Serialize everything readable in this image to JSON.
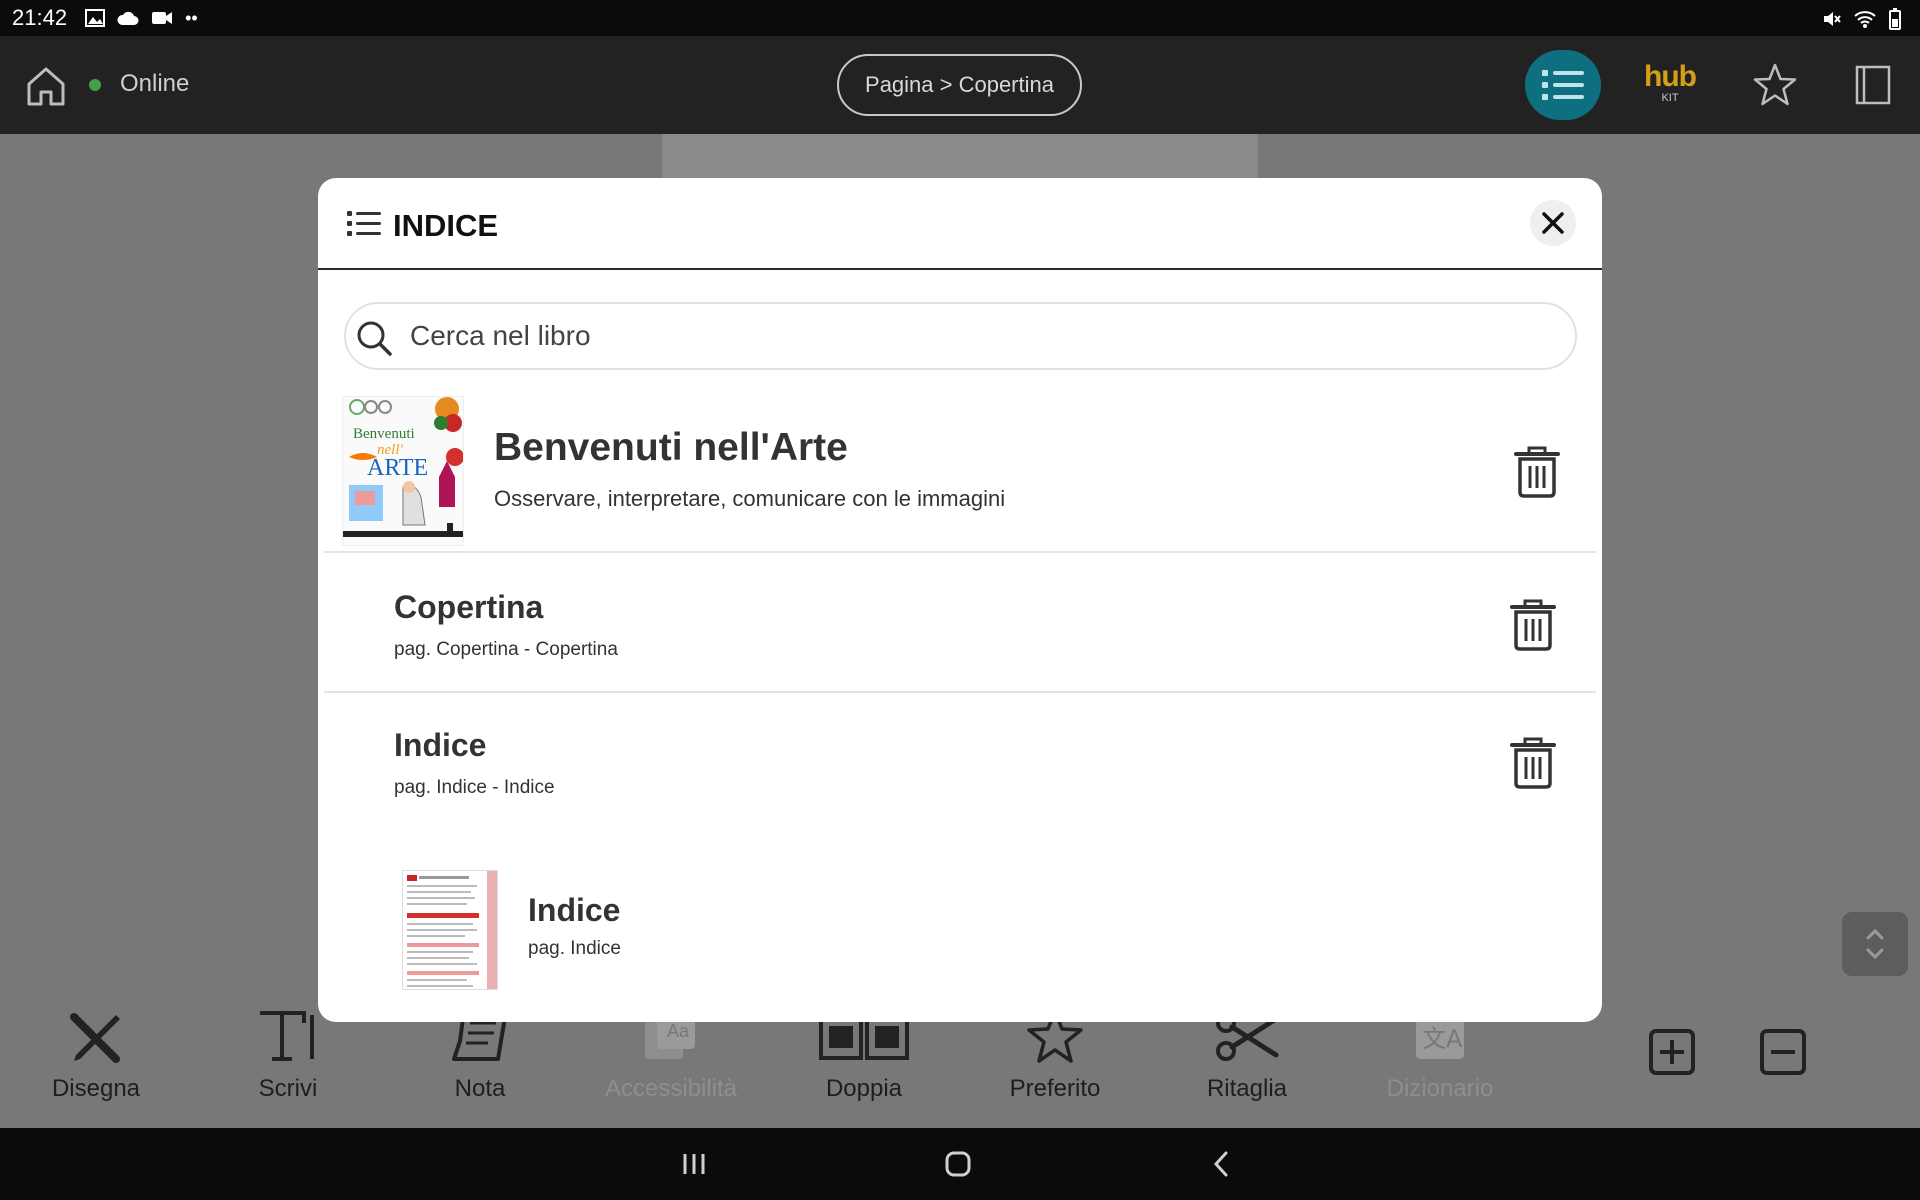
{
  "statusbar": {
    "time": "21:42"
  },
  "appbar": {
    "connection_status": "Online",
    "breadcrumb": "Pagina > Copertina",
    "hub_logo": "hub",
    "hub_logo_sub": "KIT"
  },
  "modal": {
    "title": "INDICE",
    "search_placeholder": "Cerca nel libro",
    "book": {
      "title": "Benvenuti nell'Arte",
      "subtitle": "Osservare, interpretare, comunicare con le immagini",
      "cover_text_1": "Benvenuti",
      "cover_text_2": "nell'",
      "cover_text_3": "ARTE"
    },
    "entries": [
      {
        "title": "Copertina",
        "subtitle": "pag. Copertina - Copertina"
      },
      {
        "title": "Indice",
        "subtitle": "pag. Indice - Indice"
      }
    ],
    "thumb_entry": {
      "title": "Indice",
      "subtitle": "pag. Indice"
    }
  },
  "toolbar": {
    "tools": [
      {
        "label": "Disegna",
        "icon": "pen-brush-icon",
        "enabled": true
      },
      {
        "label": "Scrivi",
        "icon": "text-icon",
        "enabled": true
      },
      {
        "label": "Nota",
        "icon": "note-icon",
        "enabled": true
      },
      {
        "label": "Accessibilità",
        "icon": "accessibility-icon",
        "enabled": false
      },
      {
        "label": "Doppia",
        "icon": "double-page-icon",
        "enabled": true
      },
      {
        "label": "Preferito",
        "icon": "star-icon",
        "enabled": true
      },
      {
        "label": "Ritaglia",
        "icon": "scissors-icon",
        "enabled": true
      },
      {
        "label": "Dizionario",
        "icon": "dictionary-icon",
        "enabled": false
      }
    ]
  },
  "colors": {
    "accent": "#0e6f80",
    "online": "#43a047",
    "hub_logo": "#d4a017"
  }
}
